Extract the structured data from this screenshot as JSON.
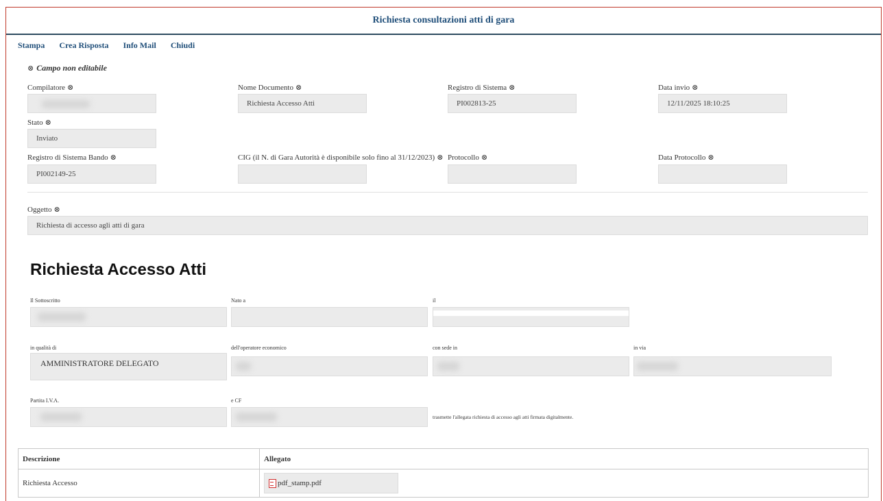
{
  "title": "Richiesta consultazioni atti di gara",
  "toolbar": {
    "stampa": "Stampa",
    "crea_risposta": "Crea Risposta",
    "info_mail": "Info Mail",
    "chiudi": "Chiudi"
  },
  "note": "Campo non editabile",
  "noneditable_symbol": "⊗",
  "fields": {
    "compilatore": {
      "label": "Compilatore",
      "value": ""
    },
    "nome_documento": {
      "label": "Nome Documento",
      "value": "Richiesta Accesso Atti"
    },
    "registro_sistema": {
      "label": "Registro di Sistema",
      "value": "PI002813-25"
    },
    "data_invio": {
      "label": "Data invio",
      "value": "12/11/2025 18:10:25"
    },
    "stato": {
      "label": "Stato",
      "value": "Inviato"
    },
    "registro_bando": {
      "label": "Registro di Sistema Bando",
      "value": "PI002149-25"
    },
    "cig": {
      "label": "CIG (il N. di Gara Autorità è disponibile solo fino al 31/12/2023)",
      "value": ""
    },
    "protocollo": {
      "label": "Protocollo",
      "value": ""
    },
    "data_protocollo": {
      "label": "Data Protocollo",
      "value": ""
    },
    "oggetto": {
      "label": "Oggetto",
      "value": "Richiesta di accesso agli atti di gara"
    }
  },
  "section_title": "Richiesta Accesso Atti",
  "form": {
    "sottoscritto": "Il Sottoscritto",
    "nato_a": "Nato a",
    "il": "il",
    "in_qualita": "in qualità di",
    "in_qualita_value": "AMMINISTRATORE DELEGATO",
    "operatore": "dell'operatore economico",
    "sede": "con sede in",
    "via": "in via",
    "piva": "Partita I.V.A.",
    "cf": "e CF",
    "trasmette": "trasmette l'allegata richiesta di accesso agli atti firmata digitalmente."
  },
  "attachments": {
    "col_descrizione": "Descrizione",
    "col_allegato": "Allegato",
    "rows": [
      {
        "descrizione": "Richiesta Accesso",
        "file": "pdf_stamp.pdf",
        "icon": "pdf-file-icon"
      }
    ]
  }
}
